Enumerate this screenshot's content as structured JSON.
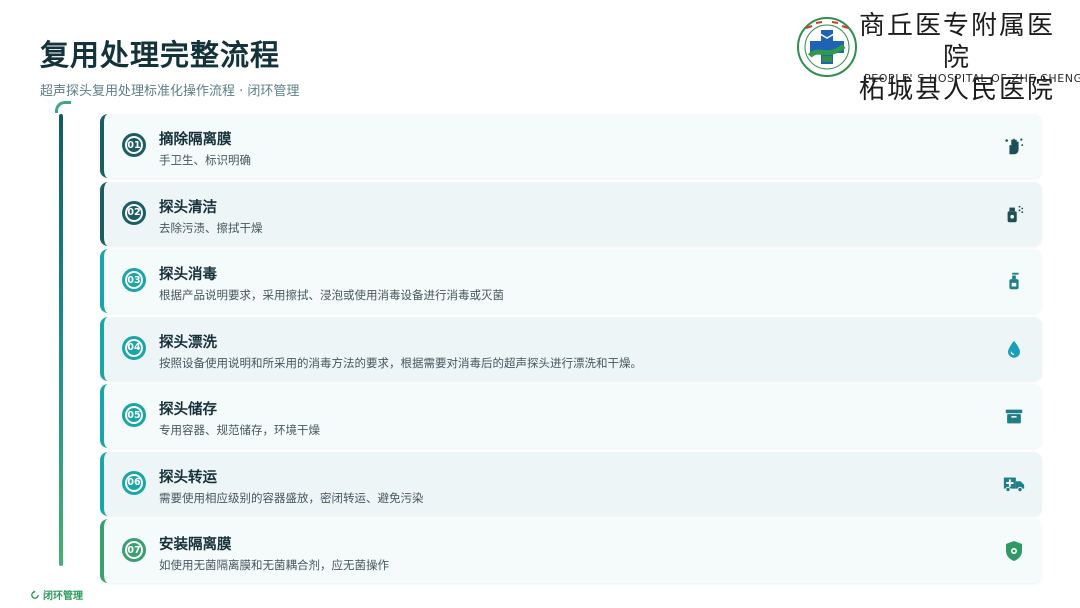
{
  "header": {
    "title": "复用处理完整流程",
    "subtitle": "超声探头复用处理标准化操作流程 · 闭环管理"
  },
  "logo": {
    "name_cn_line1": "商丘医专附属医院",
    "name_cn_line2": "柘城县人民医院",
    "name_en": "PEOPLE' S HOSPITAL OF ZHE CHENG"
  },
  "timeline": {
    "loop_label": "闭环管理"
  },
  "colors": {
    "title": "#13323b",
    "accent_dark": "#1c5d63",
    "accent_teal": "#1aa5a8",
    "accent_green": "#3aa070"
  },
  "steps": [
    {
      "number": "01",
      "title": "摘除隔离膜",
      "desc": "手卫生、标识明确",
      "icon": "hand-wash-icon",
      "color": "#1c5d63"
    },
    {
      "number": "02",
      "title": "探头清洁",
      "desc": "去除污渍、擦拭干燥",
      "icon": "spray-bottle-icon",
      "color": "#1c5d63"
    },
    {
      "number": "03",
      "title": "探头消毒",
      "desc": "根据产品说明要求，采用擦拭、浸泡或使用消毒设备进行消毒或灭菌",
      "icon": "pump-bottle-icon",
      "color": "#1aa5a8"
    },
    {
      "number": "04",
      "title": "探头漂洗",
      "desc": "按照设备使用说明和所采用的消毒方法的要求，根据需要对消毒后的超声探头进行漂洗和干燥。",
      "icon": "water-drop-icon",
      "color": "#1aa5a8"
    },
    {
      "number": "05",
      "title": "探头储存",
      "desc": "专用容器、规范储存，环境干燥",
      "icon": "storage-box-icon",
      "color": "#1aa5a8"
    },
    {
      "number": "06",
      "title": "探头转运",
      "desc": "需要使用相应级别的容器盛放，密闭转运、避免污染",
      "icon": "ambulance-icon",
      "color": "#1aa5a8"
    },
    {
      "number": "07",
      "title": "安装隔离膜",
      "desc": "如使用无菌隔离膜和无菌耦合剂，应无菌操作",
      "icon": "shield-icon",
      "color": "#3aa070"
    }
  ]
}
